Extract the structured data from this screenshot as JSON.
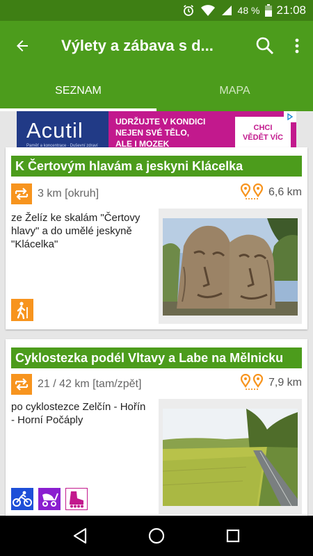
{
  "status_bar": {
    "battery": "48 %",
    "time": "21:08"
  },
  "toolbar": {
    "title": "Výlety a zábava s d...",
    "back_icon": "arrow-back-icon",
    "search_icon": "search-icon",
    "menu_icon": "more-vert-icon"
  },
  "tabs": [
    {
      "label": "SEZNAM",
      "active": true
    },
    {
      "label": "MAPA",
      "active": false
    }
  ],
  "ad": {
    "brand": "Acutil",
    "brand_sub": "Paměť a koncentrace · Duševní zdraví",
    "line1": "UDRŽUJTE V KONDICI",
    "line2": "NEJEN SVÉ TĚLO,",
    "line3": "ALE I MOZEK",
    "cta_line1": "CHCI",
    "cta_line2": "VĚDĚT VÍC",
    "colors": {
      "brand_bg": "#213a86",
      "bg": "#c2198d"
    }
  },
  "trips": [
    {
      "title": "K Čertovým hlavám a jeskyni Klácelka",
      "route": "3 km [okruh]",
      "distance": "6,6 km",
      "description": "ze Želíz ke skalám \"Čertovy hlavy\" a do umělé jeskyně \"Klácelka\"",
      "photo": "rock-heads-photo",
      "activities": [
        "hiking-icon"
      ]
    },
    {
      "title": "Cyklostezka podél Vltavy a Labe na Mělnicku",
      "route": "21 / 42 km [tam/zpět]",
      "distance": "7,9 km",
      "description": "po cyklostezce Zelčín - Hořín - Horní Počáply",
      "photo": "bike-path-photo",
      "activities": [
        "cycling-icon",
        "stroller-icon",
        "inline-skate-icon"
      ]
    }
  ],
  "colors": {
    "primary": "#4c9c1c",
    "primary_dark": "#3e7f14",
    "orange": "#f7941e",
    "blue": "#1e4fd8",
    "purple": "#8a1fd0",
    "pink": "#c2198d"
  }
}
